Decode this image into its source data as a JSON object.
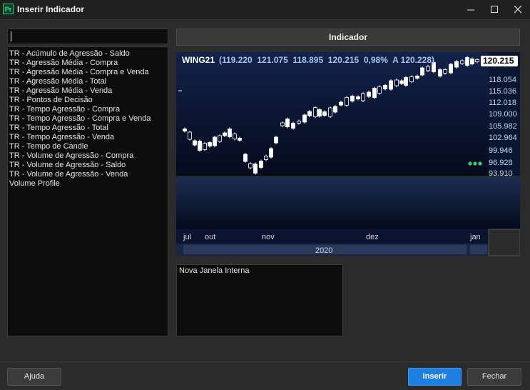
{
  "window": {
    "title": "Inserir Indicador",
    "app_icon_text": "Pr",
    "controls": [
      "minimize-icon",
      "maximize-icon",
      "close-icon"
    ]
  },
  "search": {
    "value": "",
    "placeholder": ""
  },
  "indicator_list": [
    "TR - Acúmulo de Agressão - Saldo",
    "TR - Agressão Média - Compra",
    "TR - Agressão Média - Compra e Venda",
    "TR - Agressão Média - Total",
    "TR - Agressão Média - Venda",
    "TR - Pontos de Decisão",
    "TR - Tempo Agressão - Compra",
    "TR - Tempo Agressão - Compra e Venda",
    "TR - Tempo Agressão - Total",
    "TR - Tempo Agressão - Venda",
    "TR - Tempo de Candle",
    "TR - Volume de Agressão - Compra",
    "TR - Volume de Agressão - Saldo",
    "TR - Volume de Agressão - Venda",
    "Volume Profile"
  ],
  "preview": {
    "header": "Indicador",
    "symbol": "WING21",
    "quote": "(119.220  121.075  118.895  120.215  0,98%  A 120.228)",
    "last_price": "120.215",
    "price_axis": [
      "118.054",
      "115.036",
      "112.018",
      "109.000",
      "105.982",
      "102.964",
      "99.946",
      "96.928",
      "93.910"
    ],
    "months": [
      "jul",
      "out",
      "nov",
      "dez",
      "jan"
    ],
    "year": "2020",
    "colors": {
      "chart_bg_top": "#0f1c3e",
      "chart_bg_bottom": "#050a1c",
      "candle_up": "#ffffff",
      "candle_down": "#0a1230",
      "dots": "#3cc87a"
    }
  },
  "janela": {
    "text": "Nova Janela Interna"
  },
  "buttons": {
    "help": "Ajuda",
    "insert": "Inserir",
    "close": "Fechar"
  }
}
